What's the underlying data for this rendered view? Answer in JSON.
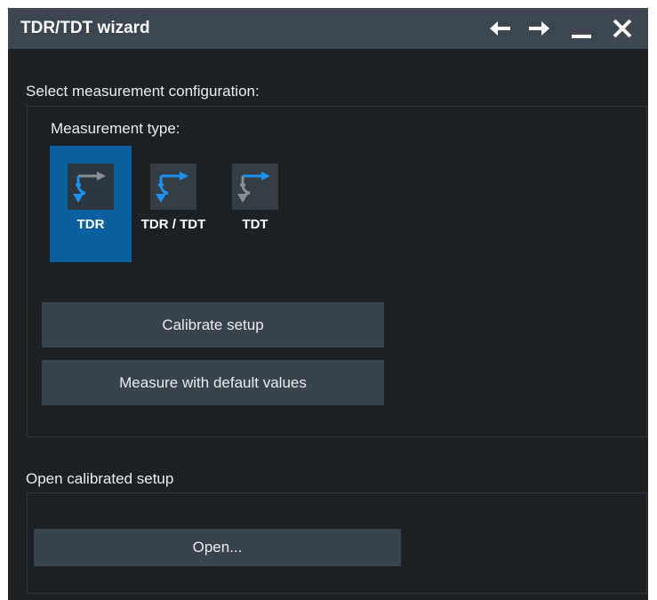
{
  "window": {
    "title": "TDR/TDT wizard"
  },
  "titlebar_icons": [
    "arrow-left-icon",
    "arrow-right-icon",
    "minimize-icon",
    "close-icon"
  ],
  "config": {
    "section_label": "Select measurement configuration:",
    "measurement_type_label": "Measurement type:",
    "types": [
      {
        "label": "TDR",
        "selected": true
      },
      {
        "label": "TDR / TDT",
        "selected": false
      },
      {
        "label": "TDT",
        "selected": false
      }
    ],
    "calibrate_label": "Calibrate setup",
    "measure_default_label": "Measure with default values"
  },
  "calibrated": {
    "section_label": "Open calibrated setup",
    "open_label": "Open..."
  },
  "colors": {
    "accent": "#0a5f9f",
    "arrow_blue": "#1e90f0",
    "arrow_gray": "#8a8f94"
  }
}
